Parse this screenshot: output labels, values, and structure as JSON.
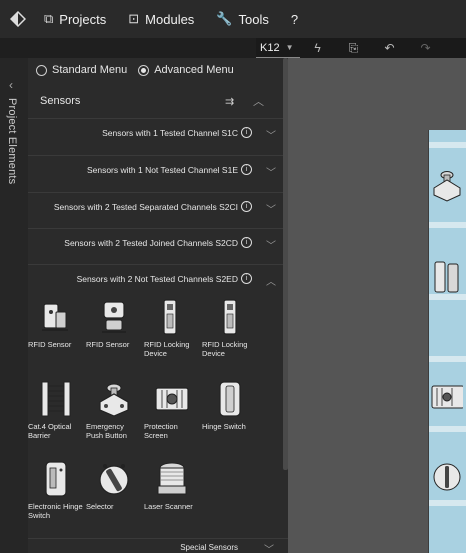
{
  "topbar": {
    "items": [
      {
        "label": "Projects",
        "icon": "projects-icon"
      },
      {
        "label": "Modules",
        "icon": "modules-icon"
      },
      {
        "label": "Tools",
        "icon": "wrench-icon"
      },
      {
        "label": "?",
        "icon": ""
      }
    ]
  },
  "toolbar": {
    "selected_module": "K12"
  },
  "sidebar": {
    "tab_label": "Project Elements"
  },
  "panel": {
    "menu_options": [
      {
        "label": "Standard Menu",
        "selected": false
      },
      {
        "label": "Advanced Menu",
        "selected": true
      }
    ],
    "section_title": "Sensors",
    "subsections": [
      {
        "label": "Sensors with 1 Tested Channel S1C",
        "expanded": false
      },
      {
        "label": "Sensors with 1 Not Tested Channel S1E",
        "expanded": false
      },
      {
        "label": "Sensors with 2 Tested Separated Channels S2CI",
        "expanded": false
      },
      {
        "label": "Sensors with 2 Tested Joined Channels S2CD",
        "expanded": false
      },
      {
        "label": "Sensors with 2 Not Tested Channels S2ED",
        "expanded": true
      }
    ],
    "components": [
      {
        "label": "RFID Sensor",
        "icon": "rfid-sensor-icon"
      },
      {
        "label": "RFID Sensor",
        "icon": "rfid-sensor-alt-icon"
      },
      {
        "label": "RFID Locking Device",
        "icon": "rfid-locking-device-icon"
      },
      {
        "label": "RFID Locking Device",
        "icon": "rfid-locking-device-alt-icon"
      },
      {
        "label": "Cat.4 Optical Barrier",
        "icon": "optical-barrier-icon"
      },
      {
        "label": "Emergency Push Button",
        "icon": "emergency-button-icon"
      },
      {
        "label": "Protection Screen",
        "icon": "protection-screen-icon"
      },
      {
        "label": "Hinge Switch",
        "icon": "hinge-switch-icon"
      },
      {
        "label": "Electronic Hinge Switch",
        "icon": "electronic-hinge-switch-icon"
      },
      {
        "label": "Selector",
        "icon": "selector-icon"
      },
      {
        "label": "Laser Scanner",
        "icon": "laser-scanner-icon"
      }
    ],
    "special_section": "Special Sensors"
  },
  "colors": {
    "topbar": "#2a2a2a",
    "panel": "#2b2b2b",
    "canvas": "#555555",
    "sheet": "#a9d1e1"
  }
}
